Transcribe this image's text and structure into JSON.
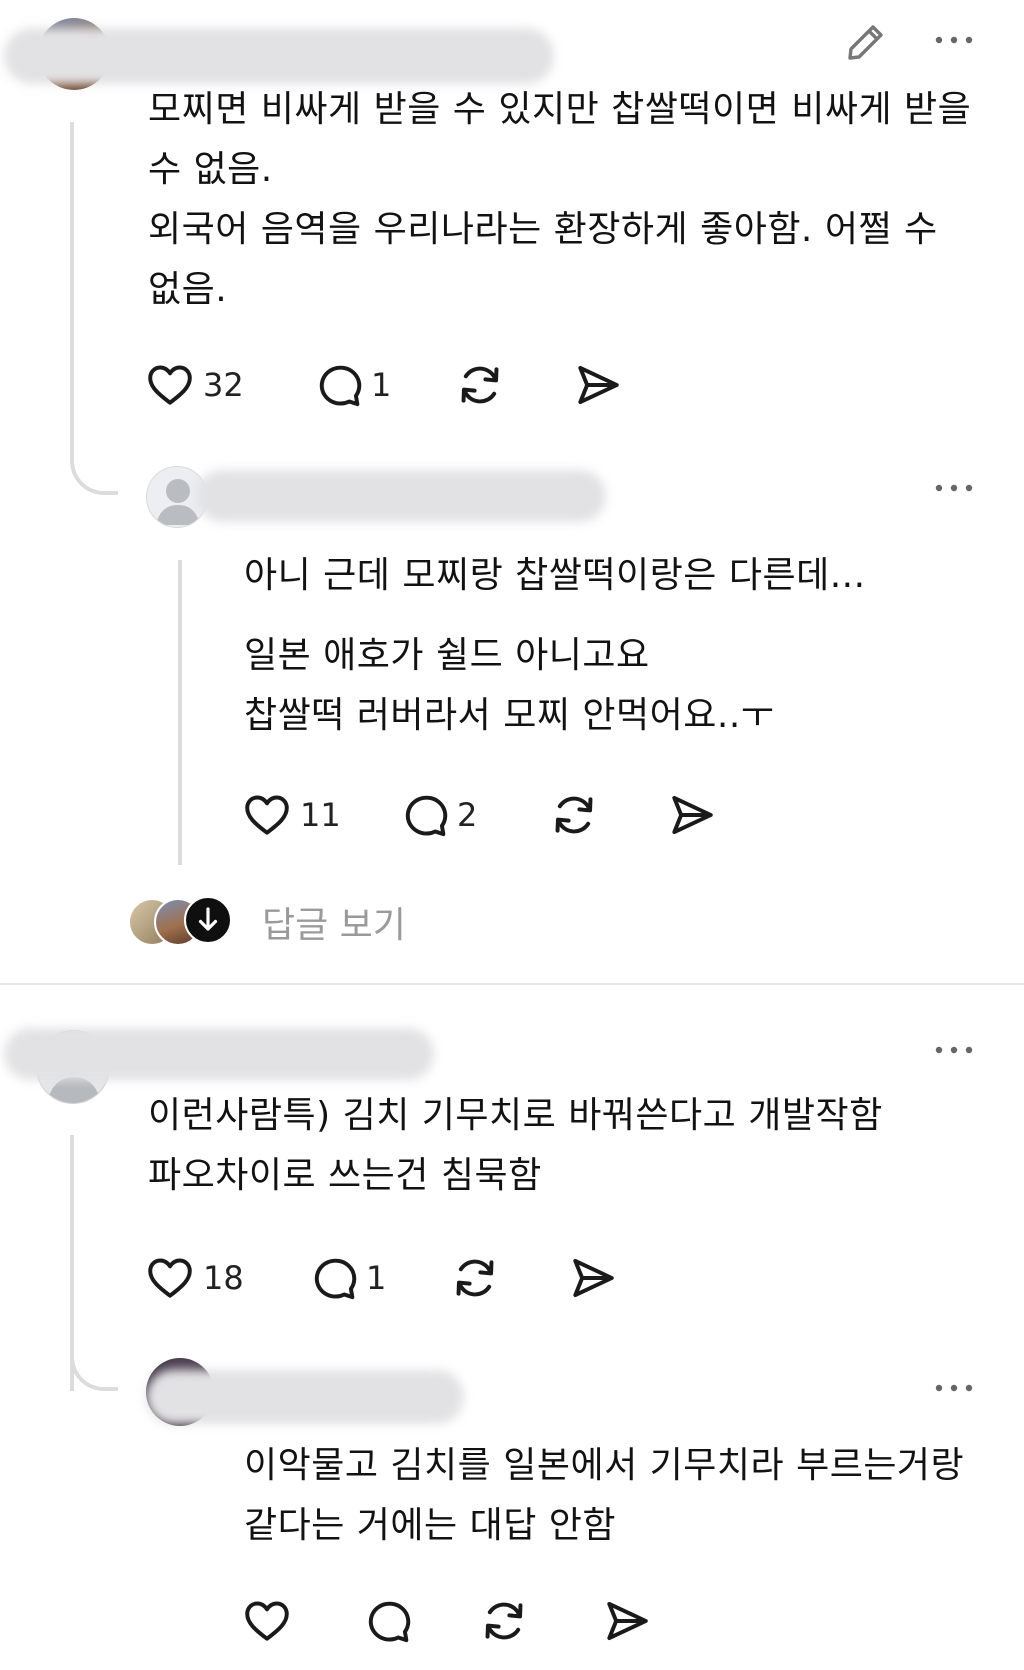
{
  "comment1": {
    "text": "모찌면 비싸게 받을 수 있지만 찹쌀떡이면 비싸게 받을\n수 없음.\n외국어 음역을 우리나라는 환장하게 좋아함. 어쩔 수\n없음.",
    "likes": "32",
    "replies": "1",
    "reply": {
      "text": "아니 근데 모찌랑 찹쌀떡이랑은 다른데...",
      "text2": "일본 애호가 쉴드 아니고요\n찹쌀떡 러버라서 모찌 안먹어요..ㅜ",
      "likes": "11",
      "replies": "2"
    },
    "view_replies_label": "답글 보기"
  },
  "comment2": {
    "text": "이런사람특) 김치 기무치로 바꿔쓴다고 개발작함\n파오차이로 쓰는건 침묵함",
    "likes": "18",
    "replies": "1",
    "reply": {
      "text": "이악물고 김치를 일본에서 기무치라 부르는거랑\n같다는 거에는 대답 안함"
    }
  },
  "icons": {
    "edit": "pencil-icon",
    "more": "more-horizontal-icon",
    "like": "heart-icon",
    "comment": "comment-bubble-icon",
    "repost": "repost-icon",
    "share": "send-icon",
    "expand": "arrow-down-icon"
  },
  "colors": {
    "text": "#121212",
    "muted": "#9a9a9a",
    "line": "#dcdcdc"
  }
}
